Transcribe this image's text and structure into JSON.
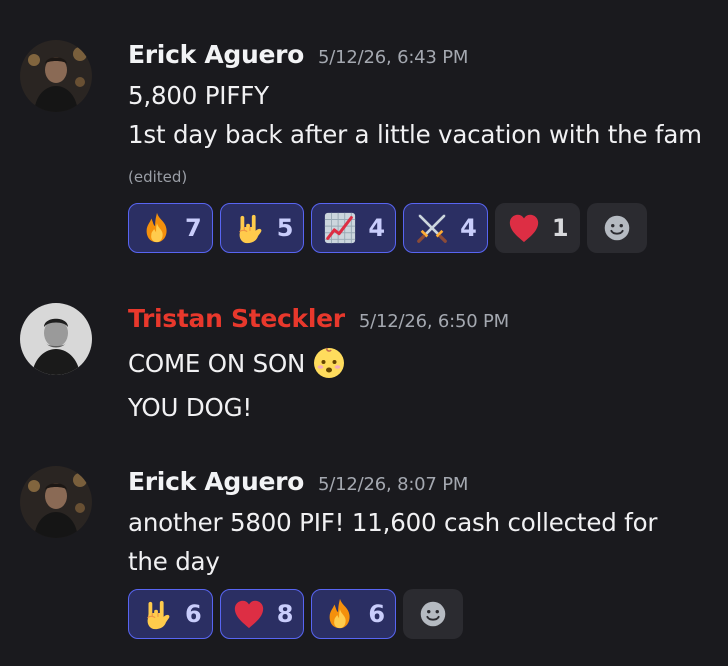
{
  "colors": {
    "background": "#1a1a1e",
    "name_default": "#f2f3f5",
    "name_red": "#e8382c",
    "reaction_active_bg": "#2b2f63",
    "reaction_active_border": "#5865f2"
  },
  "messages": [
    {
      "author": "Erick Aguero",
      "timestamp": "5/12/26, 6:43 PM",
      "lines": [
        "5,800 PIFFY",
        "1st day back after a little vacation with the fam"
      ],
      "edited": "(edited)",
      "reactions": [
        {
          "emoji": "fire-emoji",
          "count": "7",
          "active": true
        },
        {
          "emoji": "rock-on-hand-emoji",
          "count": "5",
          "active": true
        },
        {
          "emoji": "chart-increasing-emoji",
          "count": "4",
          "active": true
        },
        {
          "emoji": "crossed-swords-emoji",
          "count": "4",
          "active": true
        },
        {
          "emoji": "red-heart-emoji",
          "count": "1",
          "active": false
        }
      ]
    },
    {
      "author": "Tristan Steckler",
      "timestamp": "5/12/26, 6:50 PM",
      "lines": [
        "COME ON SON",
        "YOU DOG!"
      ],
      "inline_emoji": "baby-emoji"
    },
    {
      "author": "Erick Aguero",
      "timestamp": "5/12/26, 8:07 PM",
      "lines": [
        "another 5800 PIF! 11,600 cash collected for",
        "the day"
      ],
      "reactions": [
        {
          "emoji": "rock-on-hand-emoji",
          "count": "6",
          "active": true
        },
        {
          "emoji": "red-heart-emoji",
          "count": "8",
          "active": true
        },
        {
          "emoji": "fire-emoji",
          "count": "6",
          "active": true
        }
      ]
    }
  ]
}
